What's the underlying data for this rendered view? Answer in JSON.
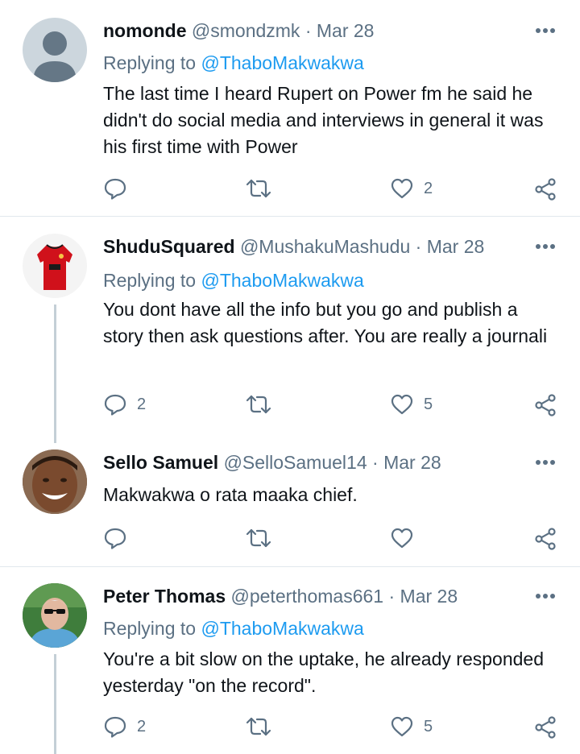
{
  "replying_prefix": "Replying to ",
  "tweets": [
    {
      "name": "nomonde",
      "handle": "@smondzmk",
      "date": "Mar 28",
      "replying_to": "@ThaboMakwakwa",
      "text": "The last time I heard Rupert on Power fm he said he didn't do social media and interviews in general it was his first time with Power",
      "replies": "",
      "retweets": "",
      "likes": "2"
    },
    {
      "name": "ShuduSquared",
      "handle": "@MushakuMashudu",
      "date": "Mar 28",
      "replying_to": "@ThaboMakwakwa",
      "text": "You dont have all the info but you go and publish a story then ask questions after. You are really a journali",
      "replies": "2",
      "retweets": "",
      "likes": "5"
    },
    {
      "name": "Sello Samuel",
      "handle": "@SelloSamuel14",
      "date": "Mar 28",
      "replying_to": "",
      "text": "Makwakwa o rata maaka chief.",
      "replies": "",
      "retweets": "",
      "likes": ""
    },
    {
      "name": "Peter Thomas",
      "handle": "@peterthomas661",
      "date": "Mar 28",
      "replying_to": "@ThaboMakwakwa",
      "text": "You're a bit slow on the uptake, he already responded yesterday \"on the record\".",
      "replies": "2",
      "retweets": "",
      "likes": "5"
    }
  ],
  "colors": {
    "name": "#0f1419",
    "secondary": "#5b7083",
    "mention": "#1d9bf0",
    "divider": "#e1e8ed",
    "thread_line": "#c4cfd6"
  },
  "icons": [
    "reply-icon",
    "retweet-icon",
    "like-icon",
    "share-icon",
    "more-icon"
  ]
}
